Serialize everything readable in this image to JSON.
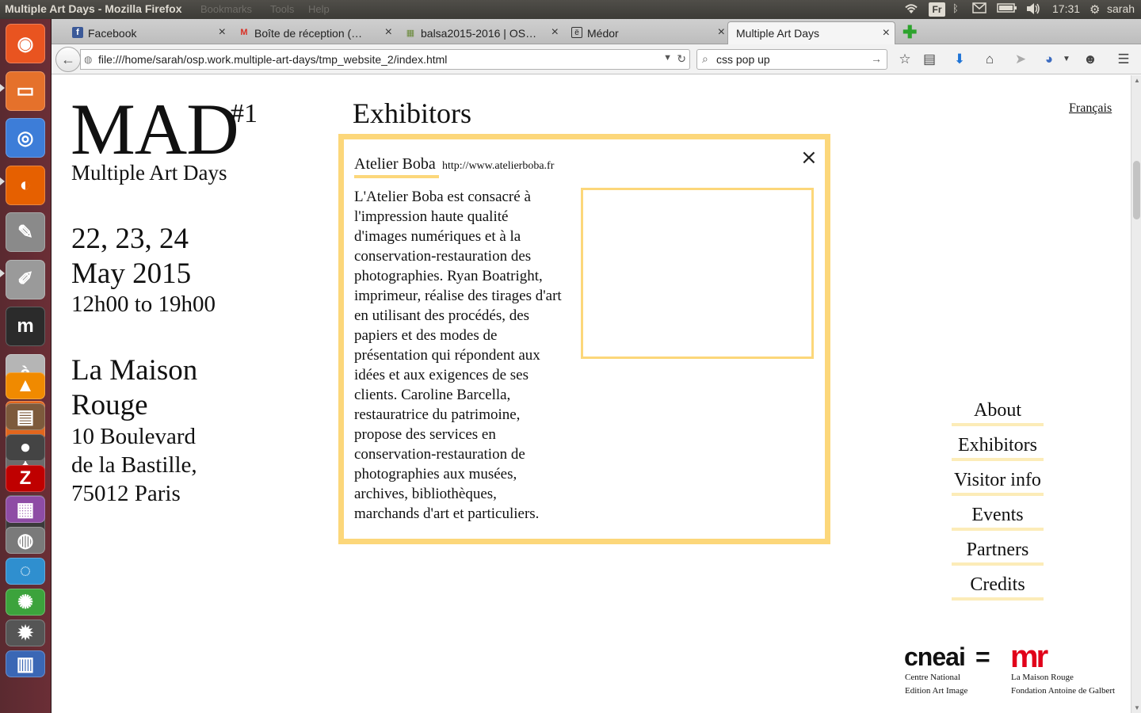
{
  "window": {
    "title": "Multiple Art Days - Mozilla Firefox"
  },
  "menus": {
    "bookmarks": "Bookmarks",
    "tools": "Tools",
    "help": "Help"
  },
  "tray": {
    "keyboard": "Fr",
    "clock": "17:31",
    "user": "sarah"
  },
  "tabs": [
    {
      "label": "Facebook",
      "icon": "facebook-icon"
    },
    {
      "label": "Boîte de réception (…",
      "icon": "gmail-icon"
    },
    {
      "label": "balsa2015-2016 | OS…",
      "icon": "osp-icon"
    },
    {
      "label": "Médor",
      "icon": "medor-icon"
    },
    {
      "label": "Multiple Art Days",
      "icon": ""
    }
  ],
  "navbar": {
    "url": "file:///home/sarah/osp.work.multiple-art-days/tmp_website_2/index.html",
    "search_value": "css pop up"
  },
  "site": {
    "logo": "MAD",
    "edition": "#1",
    "subtitle": "Multiple Art Days",
    "dates_line1": "22, 23, 24",
    "dates_line2": "May 2015",
    "hours": "12h00 to 19h00",
    "venue_line1": "La Maison",
    "venue_line2": "Rouge",
    "address_line1": "10 Boulevard",
    "address_line2": "de la Bastille,",
    "address_line3": "75012 Paris",
    "section_title": "Exhibitors",
    "language_link": "Français"
  },
  "popup": {
    "name": "Atelier Boba",
    "url": "http://www.atelierboba.fr",
    "close": "×",
    "description": "L'Atelier Boba est consacré à l'impression haute qualité d'images numériques et à la conservation-restauration des photographies. Ryan Boatright, imprimeur, réalise des tirages d'art en utilisant des procédés, des papiers et des modes de présentation qui répondent aux idées et aux exigences de ses clients. Caroline Barcella, restauratrice du patrimoine, propose des services en conservation-restauration de photographies aux musées, archives, bibliothèques, marchands d'art et particuliers."
  },
  "nav": [
    "About",
    "Exhibitors",
    "Visitor info",
    "Events",
    "Partners",
    "Credits"
  ],
  "partners": {
    "cneai_logo": "cneai",
    "equals": "=",
    "mr_logo": "mr",
    "cneai_line1": "Centre National",
    "cneai_line2": "Edition Art Image",
    "mr_line1": "La Maison Rouge",
    "mr_line2": "Fondation Antoine de Galbert"
  },
  "launcher_items": [
    {
      "name": "ubuntu-dash-icon",
      "glyph": "◉",
      "color": "#e95420"
    },
    {
      "name": "files-icon",
      "glyph": "▭",
      "color": "#e5712b"
    },
    {
      "name": "chromium-icon",
      "glyph": "◎",
      "color": "#3d7dd8"
    },
    {
      "name": "firefox-icon",
      "glyph": "◐",
      "color": "#e66000"
    },
    {
      "name": "text-editor-icon",
      "glyph": "✎",
      "color": "#8a8a8a"
    },
    {
      "name": "document-viewer-icon",
      "glyph": "✐",
      "color": "#9a9a9a"
    },
    {
      "name": "app-m-icon",
      "glyph": "m",
      "color": "#2b2b2b"
    },
    {
      "name": "character-map-icon",
      "glyph": "à",
      "color": "#b5b5b5"
    },
    {
      "name": "software-center-icon",
      "glyph": "A",
      "color": "#e2661d"
    },
    {
      "name": "settings-icon",
      "glyph": "✦",
      "color": "#6b6b6b"
    },
    {
      "name": "terminal-icon",
      "glyph": ">_",
      "color": "#3a3a3a"
    },
    {
      "name": "vlc-icon",
      "glyph": "▲",
      "color": "#f08a00"
    },
    {
      "name": "pdf-shuffler-icon",
      "glyph": "▤",
      "color": "#7d5a3c"
    },
    {
      "name": "camera-icon",
      "glyph": "●",
      "color": "#444"
    },
    {
      "name": "filezilla-icon",
      "glyph": "Z",
      "color": "#bf0000"
    },
    {
      "name": "archive-icon",
      "glyph": "▦",
      "color": "#8e4ca5"
    },
    {
      "name": "disk-icon",
      "glyph": "◍",
      "color": "#7a7a7a"
    },
    {
      "name": "globe-app-icon",
      "glyph": "◌",
      "color": "#2f8fcf"
    },
    {
      "name": "chat-app-icon",
      "glyph": "✺",
      "color": "#3ca33c"
    },
    {
      "name": "gear-app-icon",
      "glyph": "✹",
      "color": "#555"
    },
    {
      "name": "document-app-icon",
      "glyph": "▥",
      "color": "#3a67b5"
    }
  ]
}
